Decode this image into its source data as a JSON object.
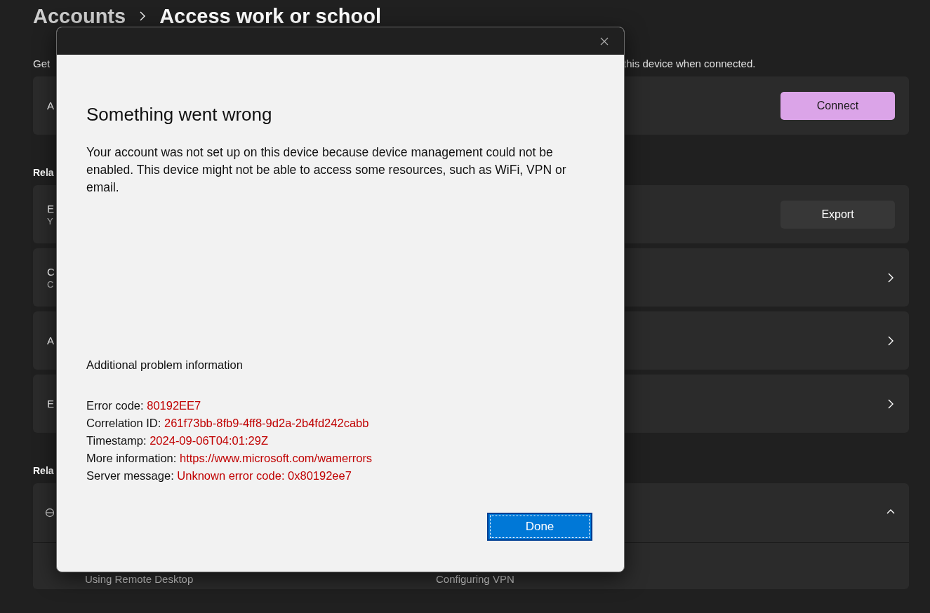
{
  "page": {
    "breadcrumb": [
      "Accounts",
      "Access work or school"
    ],
    "description": [
      "Get",
      "this device when connected."
    ]
  },
  "connect_card": {
    "label": "A",
    "button": "Connect"
  },
  "section_1": {
    "heading": "Rela",
    "rows": [
      {
        "kind": "button",
        "title": "E",
        "subtitle": "Y",
        "button": "Export"
      },
      {
        "kind": "link",
        "title": "C",
        "subtitle": "C"
      },
      {
        "kind": "link",
        "title": "A"
      },
      {
        "kind": "link",
        "title": "E"
      }
    ]
  },
  "section_2": {
    "heading": "Rela",
    "expander": {
      "expanded": true,
      "links": [
        "Using Remote Desktop",
        "Configuring VPN"
      ]
    }
  },
  "dialog": {
    "title": "Something went wrong",
    "message": "Your account was not set up on this device because device management could not be enabled. This device might not be able to access some resources, such as WiFi, VPN or email.",
    "details_heading": "Additional problem information",
    "details": [
      {
        "label": "Error code:",
        "value": "80192EE7"
      },
      {
        "label": "Correlation ID:",
        "value": "261f73bb-8fb9-4ff8-9d2a-2b4fd242cabb"
      },
      {
        "label": "Timestamp:",
        "value": "2024-09-06T04:01:29Z"
      },
      {
        "label": "More information:",
        "value": "https://www.microsoft.com/wamerrors"
      },
      {
        "label": "Server message:",
        "value": "Unknown error code: 0x80192ee7"
      }
    ],
    "button": "Done"
  }
}
